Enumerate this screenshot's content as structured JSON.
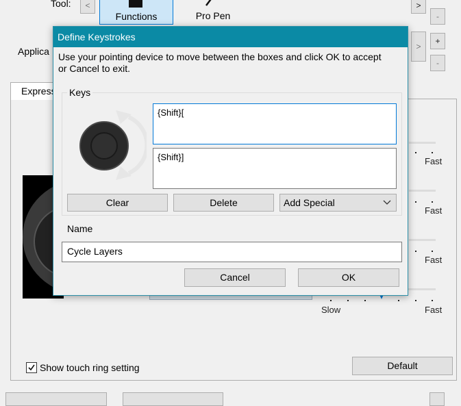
{
  "background": {
    "tool_label": "Tool:",
    "application_label": "Applica",
    "tab_label": "Express",
    "tools": [
      {
        "label": "Functions",
        "selected": true
      },
      {
        "label": "Pro Pen",
        "selected": false
      }
    ],
    "nav": {
      "left": "<",
      "right": ">",
      "plus": "+",
      "minus": "-"
    },
    "speed_labels": {
      "fast": "Fast",
      "slow": "Slow"
    },
    "show_touch_ring_label": "Show touch ring setting",
    "show_touch_ring_checked": true,
    "default_button": "Default"
  },
  "dialog": {
    "title": "Define Keystrokes",
    "instructions": "Use your pointing device to move between the boxes and click OK to accept or Cancel to exit.",
    "keys_group_label": "Keys",
    "key_clockwise": "{Shift}[",
    "key_counterclockwise": "{Shift}]",
    "clear_button": "Clear",
    "delete_button": "Delete",
    "add_special_label": "Add Special",
    "name_label": "Name",
    "name_value": "Cycle Layers",
    "cancel_button": "Cancel",
    "ok_button": "OK"
  },
  "colors": {
    "title_bar": "#0b8aa5",
    "accent": "#0078d7"
  }
}
